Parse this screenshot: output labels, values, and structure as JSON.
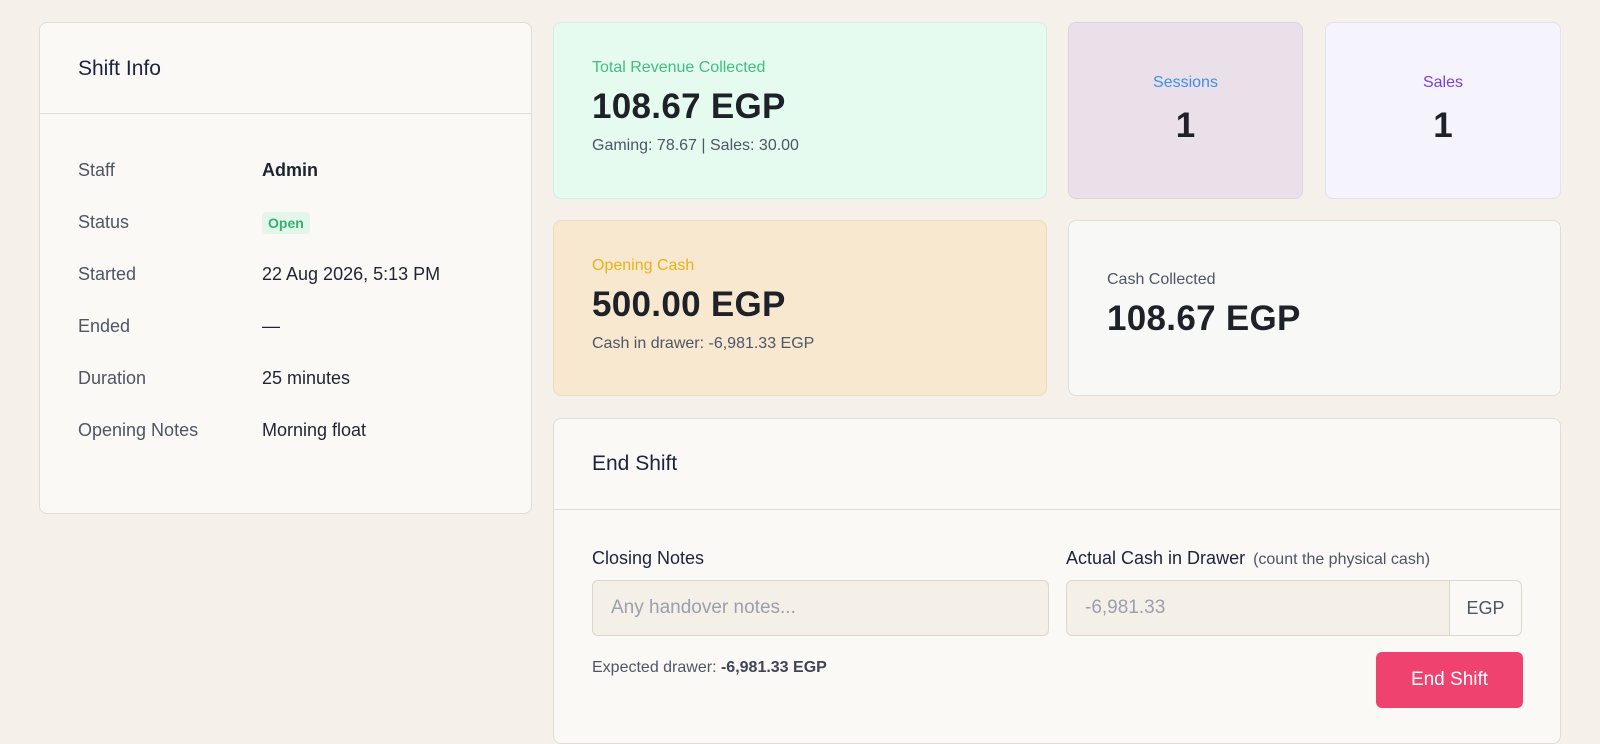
{
  "shift_info": {
    "title": "Shift Info",
    "rows": [
      {
        "label": "Staff",
        "value": "Admin"
      },
      {
        "label": "Status",
        "value": "Open"
      },
      {
        "label": "Started",
        "value": "22 Aug 2026, 5:13 PM"
      },
      {
        "label": "Ended",
        "value": "—"
      },
      {
        "label": "Duration",
        "value": "25 minutes"
      },
      {
        "label": "Opening Notes",
        "value": "Morning float"
      }
    ]
  },
  "revenue": {
    "label": "Total Revenue Collected",
    "amount": "108.67 EGP",
    "breakdown": "Gaming: 78.67 | Sales: 30.00"
  },
  "sessions": {
    "label": "Sessions",
    "count": "1"
  },
  "sales": {
    "label": "Sales",
    "count": "1"
  },
  "opening_cash": {
    "label": "Opening Cash",
    "amount": "500.00 EGP",
    "drawer": "Cash in drawer: -6,981.33 EGP"
  },
  "cash_collected": {
    "label": "Cash Collected",
    "amount": "108.67 EGP"
  },
  "end_shift": {
    "title": "End Shift",
    "closing_notes_label": "Closing Notes",
    "closing_notes_placeholder": "Any handover notes...",
    "actual_cash_label": "Actual Cash in Drawer",
    "actual_cash_hint": "(count the physical cash)",
    "actual_cash_placeholder": "-6,981.33",
    "currency": "EGP",
    "expected_label": "Expected drawer:",
    "expected_value": "-6,981.33 EGP",
    "button_label": "End Shift"
  },
  "colors": {
    "revenue_label": "#3fbf7f",
    "sessions_label": "#3f8fe8",
    "sales_label": "#7b3fe0",
    "opening_label": "#e8b21e",
    "status_badge": "#35b36d",
    "end_button": "#ef426f"
  }
}
